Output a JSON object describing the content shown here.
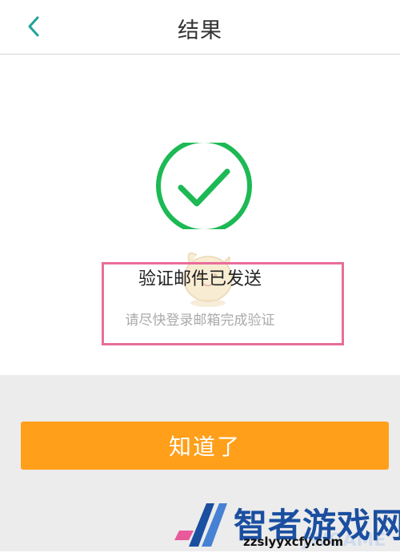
{
  "header": {
    "title": "结果",
    "back_icon": "chevron-left-icon"
  },
  "result": {
    "icon": "check-circle-icon",
    "title": "验证邮件已发送",
    "subtitle": "请尽快登录邮箱完成验证"
  },
  "actions": {
    "confirm_label": "知道了"
  },
  "watermark": {
    "site_name": "智者游戏网",
    "url": "zzslyyxcfy.com",
    "faint_text": "JWGAME"
  },
  "colors": {
    "accent_teal": "#21a39a",
    "success_green": "#1db954",
    "button_orange": "#ff9f1a",
    "highlight_pink": "#e86d9a",
    "watermark_blue": "#1a4fa0"
  }
}
